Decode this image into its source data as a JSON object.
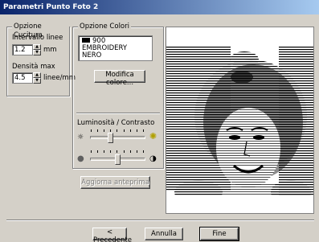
{
  "window": {
    "title": "Parametri Punto Foto 2"
  },
  "cucitura": {
    "group_title": "Opzione Cucitura",
    "intervallo_label": "Intervallo linee",
    "intervallo_value": "1.2",
    "intervallo_unit": "mm",
    "densita_label": "Densità max",
    "densita_value": "4.5",
    "densita_unit": "linee/mm"
  },
  "colori": {
    "group_title": "Opzione Colori",
    "color_number": "900",
    "color_brand": "EMBROIDERY",
    "color_name": "NERO",
    "modifica_label": "Modifica colore...",
    "swatch_color": "#000000"
  },
  "luminosita": {
    "title": "Luminosità / Contrasto",
    "brightness_level": 0.35,
    "contrast_level": 0.5
  },
  "preview": {
    "aggiorna_label": "Aggiorna anteprima"
  },
  "footer": {
    "precedente_label": "< Precedente",
    "annulla_label": "Annulla",
    "fine_label": "Fine"
  },
  "icons": {
    "sun_low": "sun-low-icon",
    "sun_high": "sun-high-icon",
    "contrast_low": "contrast-low-icon",
    "contrast_high": "contrast-high-icon"
  }
}
